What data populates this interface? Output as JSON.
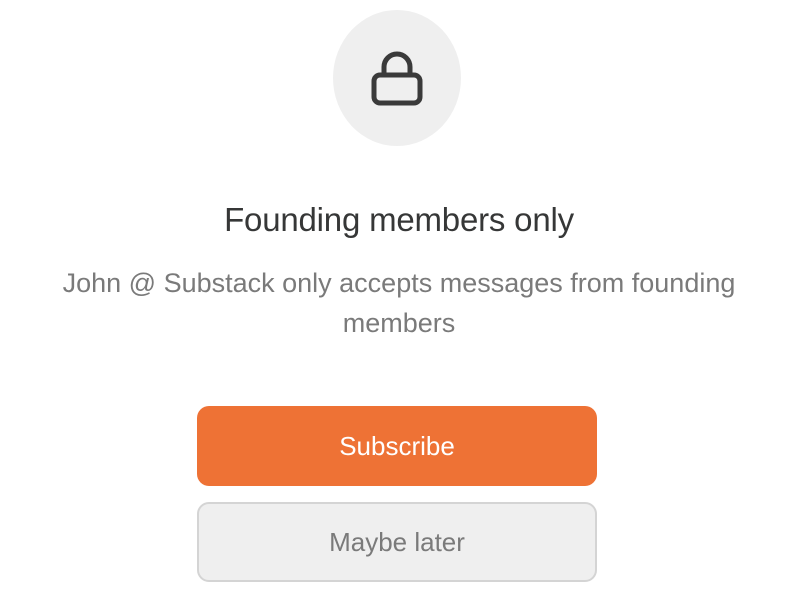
{
  "lock": {
    "icon": "lock-icon",
    "background": "#efefef"
  },
  "paywall": {
    "title": "Founding members only",
    "description": "John @ Substack only accepts messages from founding members"
  },
  "actions": {
    "subscribe_label": "Subscribe",
    "maybe_later_label": "Maybe later"
  },
  "colors": {
    "accent": "#ee7235",
    "secondary_bg": "#efefef",
    "text_primary": "#363737",
    "text_muted": "#7a7a7a"
  }
}
